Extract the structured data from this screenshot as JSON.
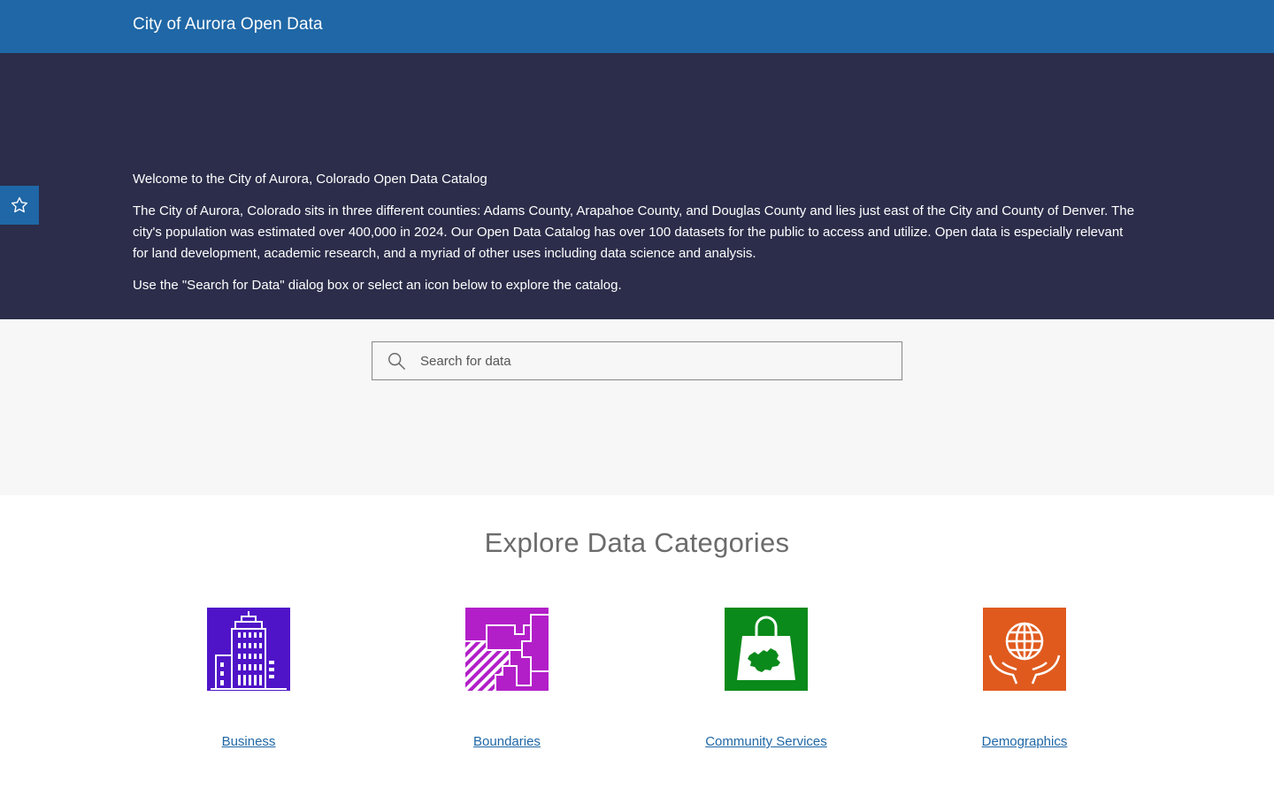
{
  "header": {
    "site_title": "City of Aurora Open Data"
  },
  "hero": {
    "welcome": "Welcome to the City of Aurora, Colorado Open Data Catalog",
    "description": "The City of Aurora, Colorado sits in three different counties: Adams County, Arapahoe County, and Douglas County and lies just east of the City and County of Denver. The city's population was estimated over 400,000 in 2024. Our Open Data Catalog has over 100 datasets for the public to access and utilize. Open data is especially relevant for land development, academic research, and a myriad of other uses including data science and analysis.",
    "instruction": "Use the \"Search for Data\" dialog box or select an icon below to explore the catalog."
  },
  "favorite": {
    "icon": "star-icon"
  },
  "search": {
    "placeholder": "Search for data",
    "icon": "search-icon"
  },
  "explore": {
    "title": "Explore Data Categories",
    "categories": [
      {
        "label": "Business",
        "icon": "building-icon",
        "color": "#5014c8"
      },
      {
        "label": "Boundaries",
        "icon": "boundaries-map-icon",
        "color": "#b21fc8"
      },
      {
        "label": "Community Services",
        "icon": "shopping-bag-map-icon",
        "color": "#0a8a1a"
      },
      {
        "label": "Demographics",
        "icon": "globe-hands-icon",
        "color": "#e05a1e"
      }
    ]
  },
  "colors": {
    "header_bg": "#1f67a6",
    "hero_bg": "#2b2d4a",
    "search_band_bg": "#f7f7f7",
    "link": "#1f67a6"
  }
}
